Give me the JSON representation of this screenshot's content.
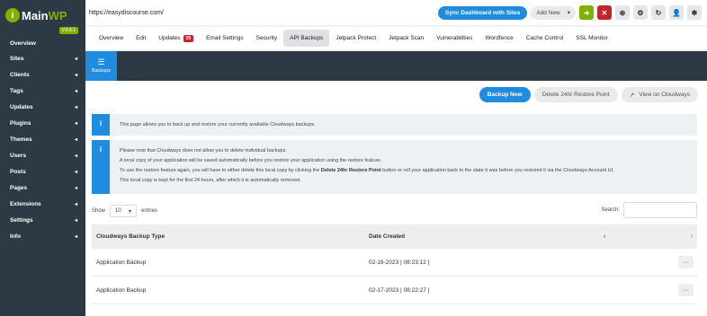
{
  "logo": {
    "icon": "i",
    "main": "Main",
    "wp": "WP",
    "version": "V.4.6.1"
  },
  "sidebar": {
    "items": [
      {
        "label": "Overview",
        "chevron": ""
      },
      {
        "label": "Sites",
        "chevron": "◂"
      },
      {
        "label": "Clients",
        "chevron": "◂"
      },
      {
        "label": "Tags",
        "chevron": "◂"
      },
      {
        "label": "Updates",
        "chevron": "◂"
      },
      {
        "label": "Plugins",
        "chevron": "◂"
      },
      {
        "label": "Themes",
        "chevron": "◂"
      },
      {
        "label": "Users",
        "chevron": "◂"
      },
      {
        "label": "Posts",
        "chevron": "◂"
      },
      {
        "label": "Pages",
        "chevron": "◂"
      },
      {
        "label": "Extensions",
        "chevron": "◂"
      },
      {
        "label": "Settings",
        "chevron": "◂"
      },
      {
        "label": "Info",
        "chevron": "◂"
      }
    ]
  },
  "topbar": {
    "url": "https://easydiscourse.com/",
    "sync_label": "Sync Dashboard with Sites",
    "add_new_label": "Add New",
    "add_new_caret": "▾",
    "icons": [
      {
        "name": "go-icon",
        "glyph": "➜",
        "color": "#7fb100"
      },
      {
        "name": "close-icon",
        "glyph": "✕",
        "color": "#c3242b"
      },
      {
        "name": "wordpress-icon",
        "glyph": "⊕",
        "color": "#e5e6e8"
      },
      {
        "name": "settings-icon",
        "glyph": "⚙",
        "color": "#e5e6e8"
      },
      {
        "name": "refresh-icon",
        "glyph": "↻",
        "color": "#e5e6e8"
      },
      {
        "name": "user-icon",
        "glyph": "👤",
        "color": "#e5e6e8"
      },
      {
        "name": "gear-icon",
        "glyph": "✱",
        "color": "#e5e6e8"
      }
    ]
  },
  "tabs": [
    {
      "label": "Overview"
    },
    {
      "label": "Edit"
    },
    {
      "label": "Updates",
      "badge": "29"
    },
    {
      "label": "Email Settings"
    },
    {
      "label": "Security"
    },
    {
      "label": "API Backups",
      "active": true
    },
    {
      "label": "Jetpack Protect"
    },
    {
      "label": "Jetpack Scan"
    },
    {
      "label": "Vulnerabilities"
    },
    {
      "label": "Wordfence"
    },
    {
      "label": "Cache Control"
    },
    {
      "label": "SSL Monitor"
    }
  ],
  "header": {
    "tab_icon": "☰",
    "tab_label": "Backups"
  },
  "actions": {
    "backup_now": "Backup Now",
    "delete_restore": "Delete 24hr Restore Point",
    "view_cloudways": "View on Cloudways",
    "view_icon": "↗"
  },
  "notices": {
    "icon": "i",
    "info1": "This page allows you to back up and restore your currently available Cloudways backups.",
    "line1": "Please note that Cloudways does not allow you to delete individual backups.",
    "line2": "A local copy of your application will be saved automatically before you restore your application using the restore feature.",
    "line3_a": "To use the restore feature again, you will have to either delete this local copy by clicking the ",
    "line3_b": "Delete 24hr Restore Point",
    "line3_c": " button or roll your application back to the state it was before you restored it via the Cloudways Account UI.",
    "line4": "This local copy is kept for the first 24 hours, after which it is automatically removed."
  },
  "table_controls": {
    "show_label": "Show",
    "entries_value": "10",
    "entries_caret": "▾",
    "entries_label": "entries",
    "search_label": "Search:"
  },
  "table": {
    "headers": {
      "type": "Cloudways Backup Type",
      "date": "Date Created",
      "sort_a": "⬍",
      "sort_b": "⬍"
    },
    "rows": [
      {
        "type": "Application Backup",
        "date": "02-16-2023 | 08:23:12 |",
        "more": "···"
      },
      {
        "type": "Application Backup",
        "date": "02-17-2023 | 08:22:27 |",
        "more": "···"
      }
    ]
  }
}
